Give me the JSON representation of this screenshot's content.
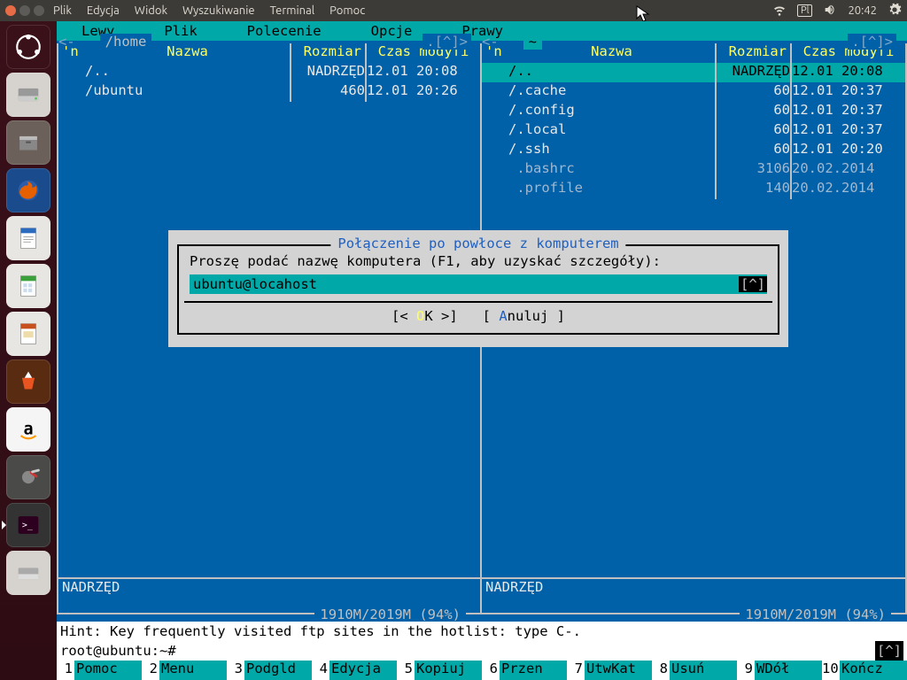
{
  "sys": {
    "menus": [
      "Plik",
      "Edycja",
      "Widok",
      "Wyszukiwanie",
      "Terminal",
      "Pomoc"
    ],
    "kb": "Pl",
    "time": "20:42"
  },
  "mc_menu": [
    "Lewy",
    "Plik",
    "Polecenie",
    "Opcje",
    "Prawy"
  ],
  "left": {
    "path": "/home",
    "sort_hint": ".[^]>",
    "cols": {
      "n": "'n",
      "name": "Nazwa",
      "size": "Rozmiar",
      "mtime": "Czas modyfi"
    },
    "rows": [
      {
        "name": "/..",
        "size": "NADRZĘD",
        "mtime": "12.01 20:08",
        "sel": false
      },
      {
        "name": "/ubuntu",
        "size": "460",
        "mtime": "12.01 20:26",
        "sel": false
      }
    ],
    "mini": "NADRZĘD",
    "disk": "1910M/2019M (94%)"
  },
  "right": {
    "path": "~",
    "sort_hint": ".[^]>",
    "cols": {
      "n": "'n",
      "name": "Nazwa",
      "size": "Rozmiar",
      "mtime": "Czas modyfi"
    },
    "rows": [
      {
        "name": "/..",
        "size": "NADRZĘD",
        "mtime": "12.01 20:08",
        "sel": true
      },
      {
        "name": "/.cache",
        "size": "60",
        "mtime": "12.01 20:37",
        "sel": false
      },
      {
        "name": "/.config",
        "size": "60",
        "mtime": "12.01 20:37",
        "sel": false
      },
      {
        "name": "/.local",
        "size": "60",
        "mtime": "12.01 20:37",
        "sel": false
      },
      {
        "name": "/.ssh",
        "size": "60",
        "mtime": "12.01 20:20",
        "sel": false
      },
      {
        "name": " .bashrc",
        "size": "3106",
        "mtime": "20.02.2014",
        "sel": false,
        "dim": true
      },
      {
        "name": " .profile",
        "size": "140",
        "mtime": "20.02.2014",
        "sel": false,
        "dim": true
      }
    ],
    "mini": "NADRZĘD",
    "disk": "1910M/2019M (94%)"
  },
  "dialog": {
    "title": "Połączenie po powłoce z komputerem",
    "prompt": "Proszę podać nazwę komputera (F1, aby uzyskać szczegóły):",
    "value": "ubuntu@locahost",
    "hist": "[^]",
    "ok_pre": "[< ",
    "ok_hk": "O",
    "ok_post": "K >]",
    "cancel_pre": "[ ",
    "cancel_hk": "A",
    "cancel_post": "nuluj ]"
  },
  "hint": "Hint: Key frequently visited ftp sites in the hotlist: type C-.",
  "prompt_text": "root@ubuntu:~#",
  "prompt_hist": "[^]",
  "fkeys": [
    {
      "n": "1",
      "l": "Pomoc"
    },
    {
      "n": "2",
      "l": "Menu"
    },
    {
      "n": "3",
      "l": "Podgld"
    },
    {
      "n": "4",
      "l": "Edycja"
    },
    {
      "n": "5",
      "l": "Kopiuj"
    },
    {
      "n": "6",
      "l": "Przen"
    },
    {
      "n": "7",
      "l": "UtwKat"
    },
    {
      "n": "8",
      "l": "Usuń"
    },
    {
      "n": "9",
      "l": "WDół"
    },
    {
      "n": "10",
      "l": "Kończ"
    }
  ]
}
